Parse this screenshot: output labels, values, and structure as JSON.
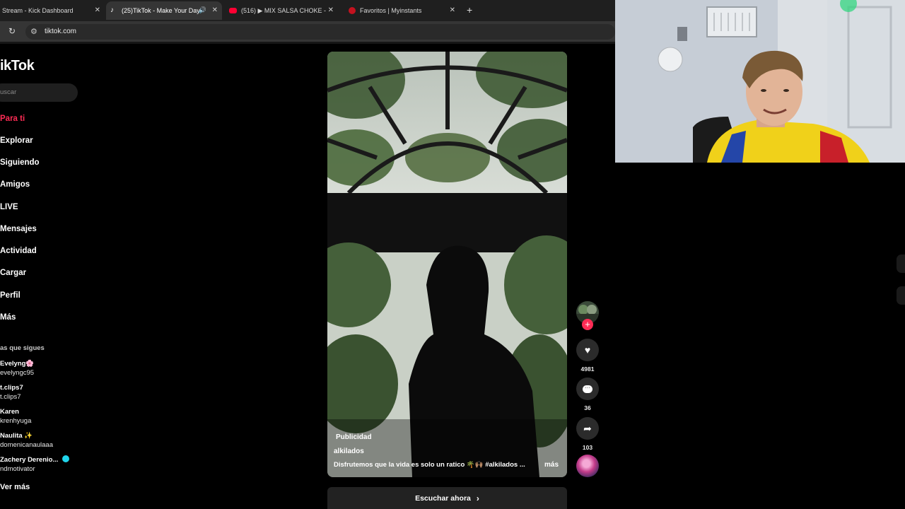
{
  "browser": {
    "tabs": [
      {
        "title": "Stream - Kick Dashboard",
        "active": false
      },
      {
        "title": "(25)TikTok - Make Your Day",
        "active": true
      },
      {
        "title": "(516) ▶ MIX SALSA CHOKE - D",
        "active": false
      },
      {
        "title": "Favoritos | Myinstants",
        "active": false
      }
    ],
    "url": "tiktok.com"
  },
  "sidebar": {
    "logo": "ikTok",
    "search_placeholder": "uscar",
    "nav": [
      {
        "label": "Para ti",
        "active": true
      },
      {
        "label": "Explorar"
      },
      {
        "label": "Siguiendo"
      },
      {
        "label": "Amigos"
      },
      {
        "label": "LIVE"
      },
      {
        "label": "Mensajes"
      },
      {
        "label": "Actividad"
      },
      {
        "label": "Cargar"
      },
      {
        "label": "Perfil"
      },
      {
        "label": "Más"
      }
    ],
    "following_header": "as que sigues",
    "accounts": [
      {
        "name": "Evelyng🌸",
        "handle": "evelyngc95"
      },
      {
        "name": "t.clips7",
        "handle": "t.clips7"
      },
      {
        "name": "Karen",
        "handle": "krenhyuga"
      },
      {
        "name": "Naulita ✨",
        "handle": "domenicanaulaaa"
      },
      {
        "name": "Zachery Derenio...",
        "handle": "ndmotivator"
      }
    ],
    "see_more": "Ver más"
  },
  "video": {
    "badge": "Publicidad",
    "author": "alkilados",
    "caption": "Disfrutemos que la vida es solo un ratico 🌴🙌🏽 #alkilados ...",
    "more": "más",
    "cta": "Escuchar ahora"
  },
  "actions": {
    "likes": "4981",
    "comments": "36",
    "shares": "103"
  },
  "colors": {
    "accent": "#fe2c55"
  }
}
